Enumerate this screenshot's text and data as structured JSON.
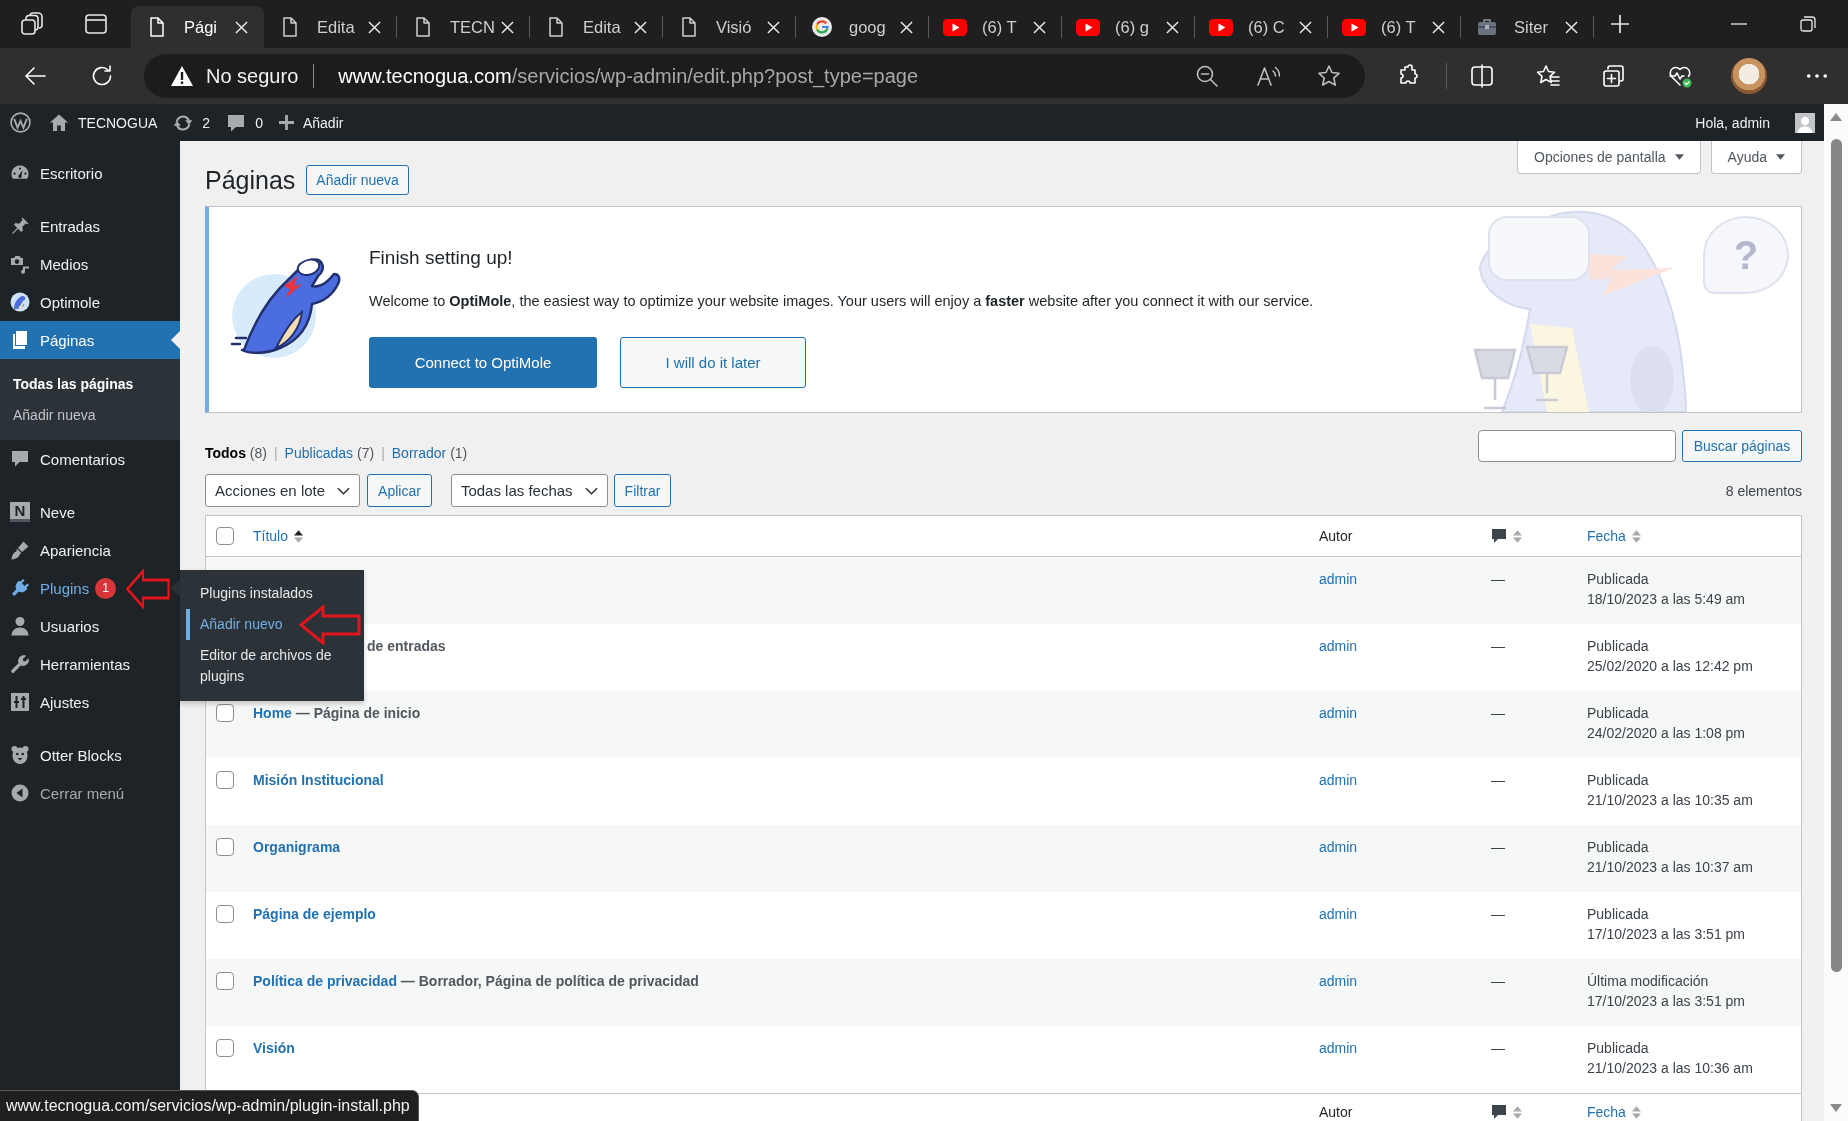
{
  "browser": {
    "tabs": [
      {
        "title": "Pági",
        "kind": "page",
        "selected": true
      },
      {
        "title": "Edita",
        "kind": "page",
        "selected": false
      },
      {
        "title": "TECN",
        "kind": "page",
        "selected": false
      },
      {
        "title": "Edita",
        "kind": "page",
        "selected": false
      },
      {
        "title": "Visió",
        "kind": "page",
        "selected": false
      },
      {
        "title": "goog",
        "kind": "google",
        "selected": false
      },
      {
        "title": "(6) T",
        "kind": "youtube",
        "selected": false
      },
      {
        "title": "(6) g",
        "kind": "youtube",
        "selected": false
      },
      {
        "title": "(6) C",
        "kind": "youtube",
        "selected": false
      },
      {
        "title": "(6) T",
        "kind": "youtube",
        "selected": false
      },
      {
        "title": "Siter",
        "kind": "tool",
        "selected": false
      }
    ],
    "address": {
      "security": "No seguro",
      "host": "www.tecnogua.com",
      "path": "/servicios/wp-admin/edit.php?post_type=page"
    }
  },
  "admin_bar": {
    "site": "TECNOGUA",
    "updates": "2",
    "comments": "0",
    "new": "Añadir",
    "greeting": "Hola, admin"
  },
  "sidebar": {
    "groups": [
      {
        "items": [
          {
            "label": "Escritorio",
            "selected": false,
            "hovered": false
          }
        ]
      },
      {
        "items": [
          {
            "label": "Entradas",
            "selected": false,
            "hovered": false
          },
          {
            "label": "Medios",
            "selected": false,
            "hovered": false
          },
          {
            "label": "Optimole",
            "selected": false,
            "hovered": false
          },
          {
            "label": "Páginas",
            "selected": true,
            "hovered": false,
            "submenu": [
              {
                "label": "Todas las páginas",
                "selected": true
              },
              {
                "label": "Añadir nueva",
                "selected": false
              }
            ]
          },
          {
            "label": "Comentarios",
            "selected": false,
            "hovered": false
          }
        ]
      },
      {
        "items": [
          {
            "label": "Neve",
            "logo_letter": "N",
            "selected": false,
            "hovered": false
          },
          {
            "label": "Apariencia",
            "selected": false,
            "hovered": false
          },
          {
            "label": "Plugins",
            "badge": "1",
            "selected": false,
            "hovered": true,
            "submenu": [
              {
                "label": "Plugins instalados",
                "hovered": false
              },
              {
                "label": "Añadir nuevo",
                "hovered": true
              },
              {
                "label": "Editor de archivos de plugins",
                "hovered": false
              }
            ]
          },
          {
            "label": "Usuarios",
            "selected": false,
            "hovered": false
          },
          {
            "label": "Herramientas",
            "selected": false,
            "hovered": false
          },
          {
            "label": "Ajustes",
            "selected": false,
            "hovered": false
          }
        ]
      },
      {
        "items": [
          {
            "label": "Otter Blocks",
            "selected": false,
            "hovered": false
          }
        ]
      }
    ],
    "collapse": {
      "label": "Cerrar menú"
    }
  },
  "page": {
    "title": "Páginas",
    "add_new": "Añadir nueva",
    "screen_options": "Opciones de pantalla",
    "help": "Ayuda"
  },
  "notice": {
    "title": "Finish setting up!",
    "text": "Welcome to **OptiMole**, the easiest way to optimize your website images. Your users will enjoy a **faster** website after you connect it with our service.",
    "primary": "Connect to OptiMole",
    "secondary": "I will do it later",
    "bubble_mark": "?"
  },
  "views": [
    {
      "label": "Todos",
      "count": "(8)",
      "selected": true,
      "separator": "|"
    },
    {
      "label": "Publicadas",
      "count": "(7)",
      "selected": false,
      "separator": "|"
    },
    {
      "label": "Borrador",
      "count": "(1)",
      "selected": false
    }
  ],
  "search": {
    "button": "Buscar páginas"
  },
  "actions": {
    "bulk": "Acciones en lote",
    "apply": "Aplicar",
    "dates": "Todas las fechas",
    "filter": "Filtrar",
    "count": "8 elementos"
  },
  "table": {
    "select_all": {
      "checked": false
    },
    "columns": [
      {
        "label": "Título",
        "kind": "sortable",
        "sorted": true
      },
      {
        "label": "Autor",
        "kind": "plain"
      },
      {
        "kind": "comments",
        "sorted": false
      },
      {
        "label": "Fecha",
        "kind": "sortable",
        "sorted": false
      }
    ],
    "rows": [
      {
        "author": "admin",
        "comments": "—",
        "status": "Publicada",
        "date": "18/10/2023 a las 5:49 am"
      },
      {
        "state": "de entradas",
        "author": "admin",
        "comments": "—",
        "status": "Publicada",
        "date": "25/02/2020 a las 12:42 pm"
      },
      {
        "checked": false,
        "title": "Home",
        "state": "— Página de inicio",
        "author": "admin",
        "comments": "—",
        "status": "Publicada",
        "date": "24/02/2020 a las 1:08 pm"
      },
      {
        "checked": false,
        "title": "Misión Institucional",
        "author": "admin",
        "comments": "—",
        "status": "Publicada",
        "date": "21/10/2023 a las 10:35 am"
      },
      {
        "checked": false,
        "title": "Organigrama",
        "author": "admin",
        "comments": "—",
        "status": "Publicada",
        "date": "21/10/2023 a las 10:37 am"
      },
      {
        "checked": false,
        "title": "Página de ejemplo",
        "author": "admin",
        "comments": "—",
        "status": "Publicada",
        "date": "17/10/2023 a las 3:51 pm"
      },
      {
        "checked": false,
        "title": "Política de privacidad",
        "state": "— Borrador, Página de política de privacidad",
        "author": "admin",
        "comments": "—",
        "status": "Última modificación",
        "date": "17/10/2023 a las 3:51 pm"
      },
      {
        "checked": false,
        "title": "Visión",
        "author": "admin",
        "comments": "—",
        "status": "Publicada",
        "date": "21/10/2023 a las 10:36 am"
      }
    ],
    "footer_columns": [
      {
        "label": "Autor",
        "kind": "plain"
      },
      {
        "kind": "comments",
        "sorted": false
      },
      {
        "label": "Fecha",
        "kind": "sortable",
        "sorted": false
      }
    ]
  },
  "status_url": "www.tecnogua.com/servicios/wp-admin/plugin-install.php"
}
